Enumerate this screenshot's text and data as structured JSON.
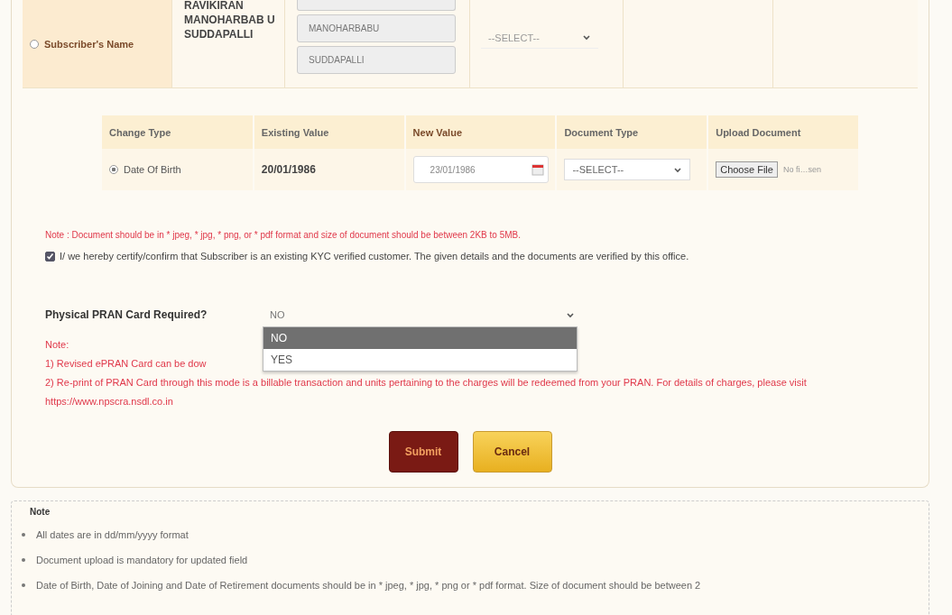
{
  "subscriber_row": {
    "change_type": "Subscriber's Name",
    "selected": false,
    "existing_value": "RAVIKIRAN MANOHARBAB U SUDDAPALLI",
    "name_fields": [
      "MANOHARBABU",
      "SUDDAPALLI"
    ],
    "document_type": "--SELECT--"
  },
  "change_table": {
    "columns": [
      "Change Type",
      "Existing Value",
      "New Value",
      "Document Type",
      "Upload Document"
    ],
    "rows": [
      {
        "change_type": "Date Of Birth",
        "selected": true,
        "existing_value": "20/01/1986",
        "new_value": "23/01/1986",
        "document_type": "--SELECT--",
        "file_button": "Choose File",
        "file_status": "No fi…sen"
      }
    ]
  },
  "note": "Note : Document should be in * jpeg, * jpg, * png, or * pdf format and size of document should be between 2KB to 5MB.",
  "certify": {
    "checked": true,
    "text": "I/ we hereby certify/confirm that Subscriber is an existing KYC verified customer. The given details and the documents are verified by this office."
  },
  "physical_card": {
    "label": "Physical PRAN Card Required?",
    "value": "NO",
    "options": [
      {
        "label": "NO",
        "selected": true
      },
      {
        "label": "YES",
        "selected": false
      }
    ]
  },
  "pran_note": {
    "title": "Note:",
    "lines": [
      "1) Revised ePRAN Card can be dow",
      "2) Re-print of PRAN Card through this mode is a billable transaction and units pertaining to the charges will be redeemed from your PRAN. For details of charges, please visit https://www.npscra.nsdl.co.in"
    ]
  },
  "buttons": [
    {
      "label": "Submit",
      "kind": "primary"
    },
    {
      "label": "Cancel",
      "kind": "secondary"
    }
  ],
  "notes": {
    "title": "Note",
    "items": [
      "All dates are in dd/mm/yyyy format",
      "Document upload is mandatory for updated field",
      "Date of Birth, Date of Joining and Date of Retirement documents should be in * jpeg, * jpg, * png or * pdf format. Size of document should be between 2"
    ]
  }
}
